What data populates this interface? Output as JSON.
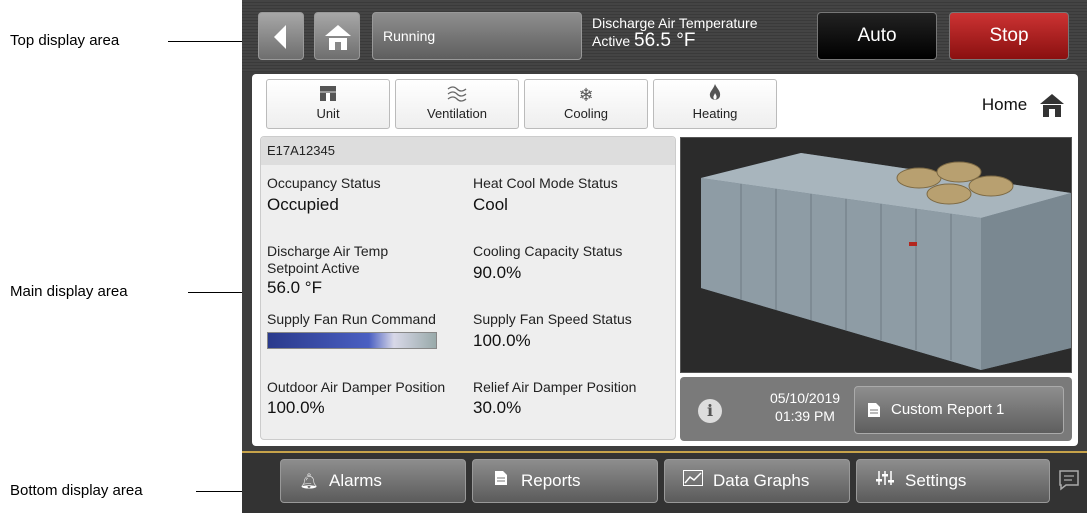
{
  "callouts": {
    "top": "Top display area",
    "main": "Main display area",
    "bottom": "Bottom display area"
  },
  "topbar": {
    "status": "Running",
    "dat_title": "Discharge Air Temperature",
    "dat_active_label": "Active",
    "dat_value": "56.5 °F",
    "auto_label": "Auto",
    "stop_label": "Stop",
    "stop_color": "#b81c1c"
  },
  "nav": {
    "tabs": [
      {
        "label": "Unit",
        "icon": "unit-icon"
      },
      {
        "label": "Ventilation",
        "icon": "ventilation-icon"
      },
      {
        "label": "Cooling",
        "icon": "snowflake-icon"
      },
      {
        "label": "Heating",
        "icon": "flame-icon"
      }
    ],
    "home_label": "Home"
  },
  "info": {
    "serial": "E17A12345",
    "occupancy_label": "Occupancy Status",
    "occupancy_value": "Occupied",
    "heatcool_label": "Heat Cool Mode Status",
    "heatcool_value": "Cool",
    "dat_sp_label1": "Discharge Air Temp",
    "dat_sp_label2": "Setpoint Active",
    "dat_sp_value": "56.0 °F",
    "cooling_cap_label": "Cooling Capacity Status",
    "cooling_cap_value": "90.0%",
    "fan_run_label": "Supply Fan Run Command",
    "fan_speed_label": "Supply Fan Speed Status",
    "fan_speed_value": "100.0%",
    "oad_label": "Outdoor Air Damper Position",
    "oad_value": "100.0%",
    "rad_label": "Relief Air Damper Position",
    "rad_value": "30.0%"
  },
  "status_panel": {
    "date": "05/10/2019",
    "time": "01:39 PM",
    "report_label": "Custom Report 1"
  },
  "bottom": {
    "alarms_label": "Alarms",
    "reports_label": "Reports",
    "graphs_label": "Data Graphs",
    "settings_label": "Settings"
  }
}
